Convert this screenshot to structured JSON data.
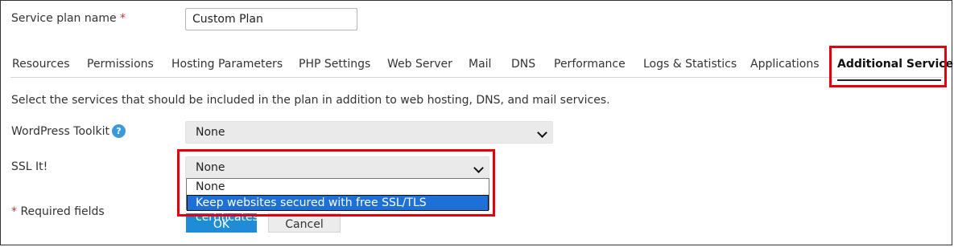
{
  "form": {
    "plan_name_label": "Service plan name",
    "required_mark": "*",
    "plan_name_value": "Custom Plan"
  },
  "tabs": [
    {
      "label": "Resources"
    },
    {
      "label": "Permissions"
    },
    {
      "label": "Hosting Parameters"
    },
    {
      "label": "PHP Settings"
    },
    {
      "label": "Web Server"
    },
    {
      "label": "Mail"
    },
    {
      "label": "DNS"
    },
    {
      "label": "Performance"
    },
    {
      "label": "Logs & Statistics"
    },
    {
      "label": "Applications"
    },
    {
      "label": "Additional Services"
    }
  ],
  "active_tab": "Additional Services",
  "description": "Select the services that should be included in the plan in addition to web hosting, DNS, and mail services.",
  "wp_toolkit": {
    "label": "WordPress Toolkit",
    "help_icon": "?",
    "value": "None"
  },
  "ssl_it": {
    "label": "SSL It!",
    "value": "None",
    "options": [
      {
        "label": "None",
        "selected": false
      },
      {
        "label": "Keep websites secured with free SSL/TLS certificates",
        "selected": true
      }
    ]
  },
  "footer": {
    "required_fields": "Required fields",
    "ok_label": "OK",
    "cancel_label": "Cancel"
  },
  "colors": {
    "highlight_border": "#e2000f",
    "selected_option": "#1e6fd6",
    "ok_button": "#1e8cd6"
  }
}
